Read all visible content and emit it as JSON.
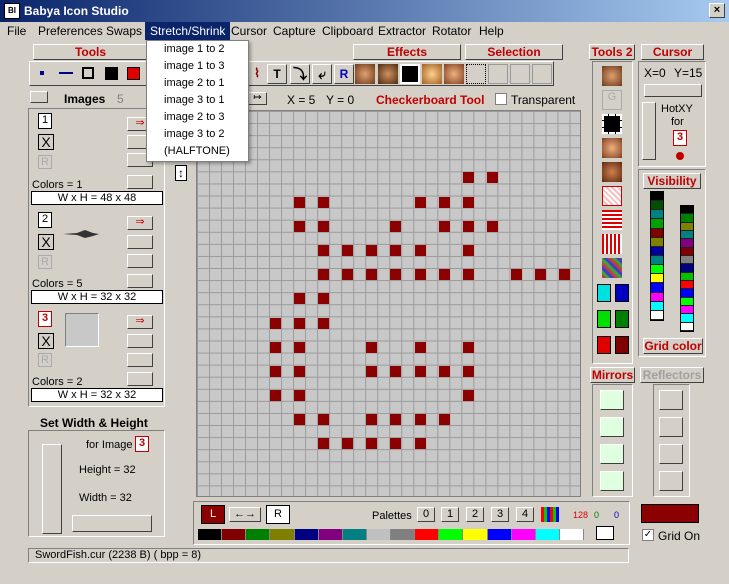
{
  "window": {
    "title": "Babya Icon Studio",
    "app_icon": "BI",
    "close_glyph": "×"
  },
  "menu": [
    "File",
    "Preferences",
    "Swaps",
    "Stretch/Shrink",
    "Cursor",
    "Capture",
    "Clipboard",
    "Extractor",
    "Rotator",
    "Help"
  ],
  "dropdown": [
    "image 1 to 2",
    "image 1 to 3",
    "image 2 to 1",
    "image 3 to 1",
    "image 2 to 3",
    "image 3 to 2",
    "(HALFTONE)"
  ],
  "headers": {
    "tools": "Tools",
    "effects": "Effects",
    "selection": "Selection",
    "tools2": "Tools 2",
    "cursor": "Cursor"
  },
  "toolbar": {
    "t": "T",
    "r": "R",
    "flip": "↔",
    "vflip": "↕"
  },
  "images_panel": {
    "label": "Images",
    "count": "5",
    "colors1": "Colors = 1",
    "wh1": "W x H = 48 x 48",
    "colors2": "Colors = 5",
    "wh2": "W x H = 32 x 32",
    "colors3": "Colors = 2",
    "wh3": "W x H = 32 x 32",
    "n1": "1",
    "n2": "2",
    "n3": "3",
    "x": "X",
    "r": "R"
  },
  "status_row": {
    "x": "X = 5",
    "y": "Y = 0",
    "tool": "Checkerboard Tool",
    "transparent": "Transparent"
  },
  "cursor_panel": {
    "x": "X=0",
    "y": "Y=15",
    "hot": "HotXY",
    "for": "for",
    "num": "3"
  },
  "visibility": "Visibility",
  "grid_color": "Grid color",
  "mirrors": "Mirrors",
  "reflectors": "Reflectors",
  "setwh": {
    "title": "Set Width & Height",
    "for_image": "for Image",
    "num": "3",
    "height": "Height = 32",
    "width": "Width = 32"
  },
  "bottom": {
    "L": "L",
    "R": "R",
    "arrow": "←→",
    "palettes": "Palettes",
    "p0": "0",
    "p1": "1",
    "p2": "2",
    "p3": "3",
    "p4": "4",
    "r": "128",
    "g": "0",
    "b": "0",
    "gridon": "Grid On"
  },
  "statusbar": "SwordFish.cur (2238 B) ( bpp = 8)",
  "colors": {
    "accent": "#c00000",
    "selected": "#0a246a",
    "pixel": "#8b0000"
  },
  "palette": [
    "#000000",
    "#800000",
    "#008000",
    "#808000",
    "#000080",
    "#800080",
    "#008080",
    "#c0c0c0",
    "#808080",
    "#ff0000",
    "#00ff00",
    "#ffff00",
    "#0000ff",
    "#ff00ff",
    "#00ffff",
    "#ffffff"
  ],
  "visA": [
    "#000",
    "#005000",
    "#008080",
    "#00a000",
    "#800000",
    "#808000",
    "#0000a0",
    "#008080",
    "#00ff00",
    "#ffff00",
    "#0000ff",
    "#ff00ff",
    "#00ffff",
    "#fff"
  ],
  "visB": [
    "#000",
    "#008000",
    "#808000",
    "#008080",
    "#800080",
    "#800000",
    "#808080",
    "#000080",
    "#00c000",
    "#ff0000",
    "#0000ff",
    "#00ff00",
    "#ff00ff",
    "#00ffff",
    "#fff"
  ]
}
